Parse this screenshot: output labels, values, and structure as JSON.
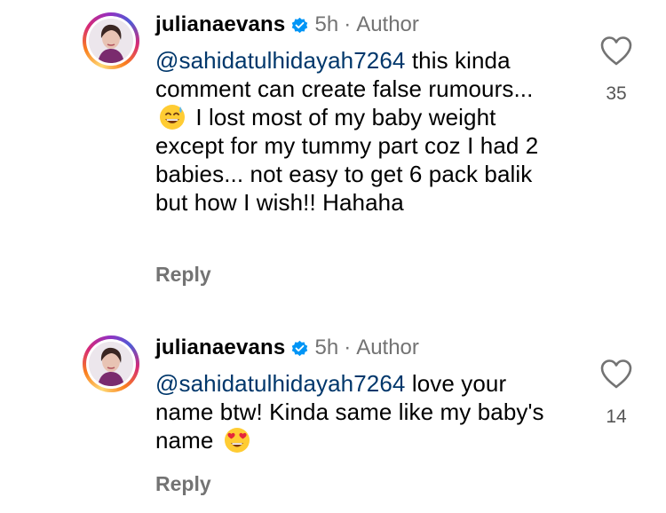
{
  "comments": [
    {
      "username": "julianaevans",
      "time": "5h",
      "separator": "·",
      "role": "Author",
      "mention": "@sahidatulhidayah7264",
      "text_before_emoji": " this kinda comment can create false rumours... ",
      "emoji": "sweat-smile-emoji",
      "text_after_emoji": " I lost most of my baby weight except for my tummy part coz I had 2 babies... not easy to get 6 pack balik but how I wish!! Hahaha",
      "likes": "35",
      "reply_label": "Reply"
    },
    {
      "username": "julianaevans",
      "time": "5h",
      "separator": "·",
      "role": "Author",
      "mention": "@sahidatulhidayah7264",
      "text_before_emoji": " love your name btw! Kinda same like my baby's name ",
      "emoji": "heart-eyes-emoji",
      "text_after_emoji": "",
      "likes": "14",
      "reply_label": "Reply"
    }
  ],
  "colors": {
    "mention": "#00376b",
    "secondary_text": "#737373",
    "verified_badge": "#0095f6"
  }
}
